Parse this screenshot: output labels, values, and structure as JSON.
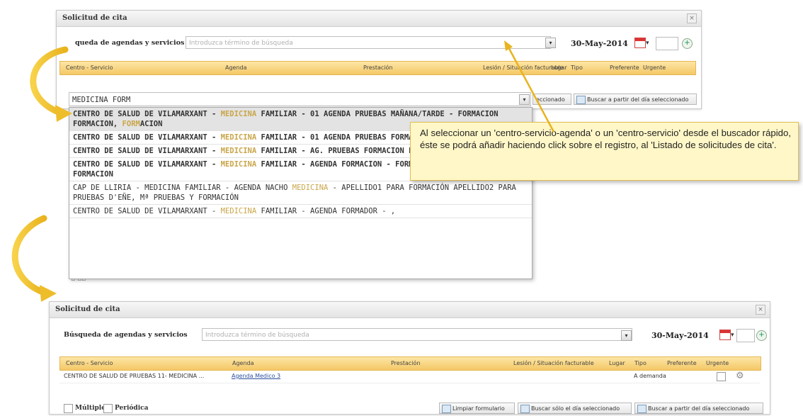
{
  "top_panel": {
    "title": "Solicitud de cita",
    "close_icon": "close-icon",
    "search_label": "queda de agendas y servicios",
    "search_placeholder": "Introduzca término de búsqueda",
    "date": "30-May-2014",
    "calendar_icon": "calendar-icon",
    "calendar_arrow": "▾",
    "columns": [
      "Centro - Servicio",
      "Agenda",
      "Prestación",
      "Lesión / Situación facturable",
      "Lugar",
      "Tipo",
      "Preferente",
      "Urgente"
    ]
  },
  "quick_search": {
    "value": "MEDICINA FORM",
    "btn_selected_day": "eccionado",
    "btn_from_selected": "Buscar a partir del día seleccionado"
  },
  "results": [
    {
      "parts": [
        {
          "t": "CENTRO DE SALUD DE VILAMARXANT - "
        },
        {
          "t": "MEDICINA",
          "h": true
        },
        {
          "t": " FAMILIAR - 01 AGENDA PRUEBAS MAÑANA/TARDE - FORMACION FORMACION, "
        },
        {
          "t": "FORM",
          "h": true
        },
        {
          "t": "ACION"
        }
      ]
    },
    {
      "parts": [
        {
          "t": "CENTRO DE SALUD DE VILAMARXANT - "
        },
        {
          "t": "MEDICINA",
          "h": true
        },
        {
          "t": " FAMILIAR - 01 AGENDA PRUEBAS FORMACION FORMACION, "
        },
        {
          "t": "FORM",
          "h": true
        },
        {
          "t": "ACION"
        }
      ]
    },
    {
      "parts": [
        {
          "t": "CENTRO DE SALUD DE VILAMARXANT - "
        },
        {
          "t": "MEDICINA",
          "h": true
        },
        {
          "t": " FAMILIAR - AG. PRUEBAS FORMACION FORMACION, FORMACION"
        }
      ]
    },
    {
      "parts": [
        {
          "t": "CENTRO DE SALUD DE VILAMARXANT - "
        },
        {
          "t": "MEDICINA",
          "h": true
        },
        {
          "t": " FAMILIAR - AGENDA FORMACION - FORMACION FORMACION, FORMACION"
        }
      ]
    },
    {
      "plain": true,
      "parts": [
        {
          "t": "CAP DE LLIRIA - MEDICINA FAMILIAR - AGENDA NACHO "
        },
        {
          "t": "MEDICINA",
          "h": true
        },
        {
          "t": " - APELLIDO1 PARA FORMACIÓN APELLIDO2 PARA PRUEBAS D'EÑE, Mª PRUEBAS Y FORMACIÓN"
        }
      ]
    },
    {
      "plain": true,
      "parts": [
        {
          "t": "CENTRO DE SALUD DE VILAMARXANT - "
        },
        {
          "t": "MEDICINA",
          "h": true
        },
        {
          "t": " FAMILIAR - AGENDA FORMADOR - ,"
        }
      ]
    }
  ],
  "tooltip": {
    "text": "Al seleccionar un 'centro-servicio-agenda' o un 'centro-servicio' desde el buscador rápido, éste se podrá añadir haciendo click sobre el registro, al 'Listado de solicitudes de cita'."
  },
  "bottom_panel": {
    "title": "Solicitud de cita",
    "search_label": "Búsqueda de agendas y servicios",
    "search_placeholder": "Introduzca término de búsqueda",
    "date": "30-May-2014",
    "columns": [
      "Centro - Servicio",
      "Agenda",
      "Prestación",
      "Lesión / Situación facturable",
      "Lugar",
      "Tipo",
      "Preferente",
      "Urgente"
    ],
    "row": {
      "centro": "CENTRO DE SALUD DE PRUEBAS 11- MEDICINA ...",
      "agenda": "Agenda Medico 3",
      "tipo": "A demanda"
    },
    "multiple_label": "Múltiple",
    "periodica_label": "Periódica",
    "btn_clear": "Limpiar formulario",
    "btn_only_day": "Buscar sólo el día seleccionado",
    "btn_from_day": "Buscar a partir del día seleccionado"
  },
  "colors": {
    "arrow": "#f2c12e",
    "header_orange": "#f4c866",
    "highlight": "#c9a64a",
    "tooltip_bg": "#fff7c7"
  }
}
